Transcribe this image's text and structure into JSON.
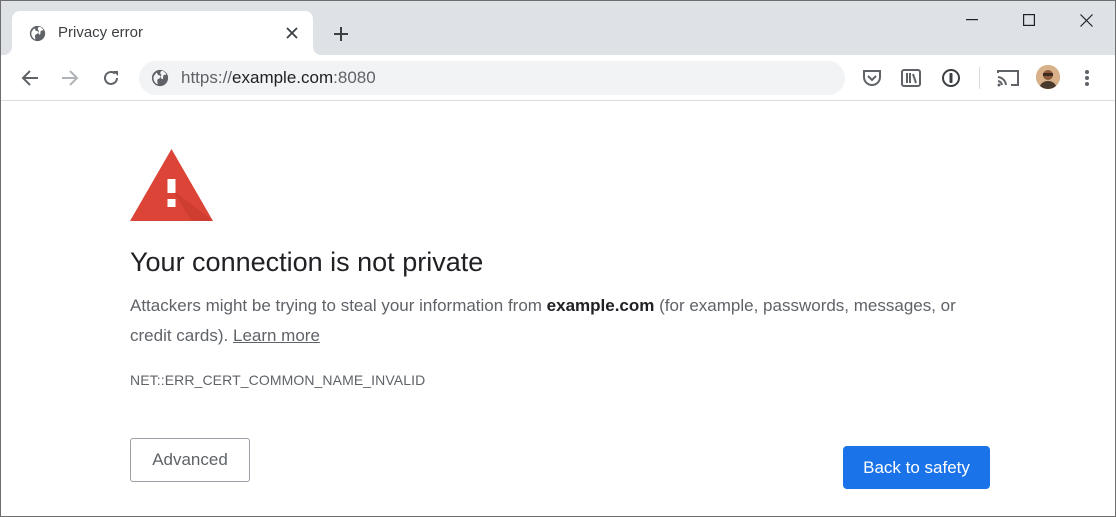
{
  "tab": {
    "title": "Privacy error",
    "favicon": "globe-icon"
  },
  "window_controls": [
    "minimize",
    "maximize",
    "close"
  ],
  "toolbar": {
    "url_prefix": "https://",
    "url_host": "example.com",
    "url_suffix": ":8080",
    "site_info_icon": "globe-icon",
    "extensions": [
      "pocket-icon",
      "library-icon",
      "password-manager-icon",
      "cast-icon",
      "avatar",
      "menu-icon"
    ]
  },
  "content": {
    "heading": "Your connection is not private",
    "desc_prefix": "Attackers might be trying to steal your information from ",
    "desc_host": "example.com",
    "desc_suffix": " (for example, passwords, messages, or credit cards). ",
    "learn_more": "Learn more",
    "error_code": "NET::ERR_CERT_COMMON_NAME_INVALID",
    "advanced_label": "Advanced",
    "back_label": "Back to safety"
  },
  "colors": {
    "accent": "#1a73e8",
    "warning": "#db4437",
    "tab_strip": "#dee1e6"
  }
}
